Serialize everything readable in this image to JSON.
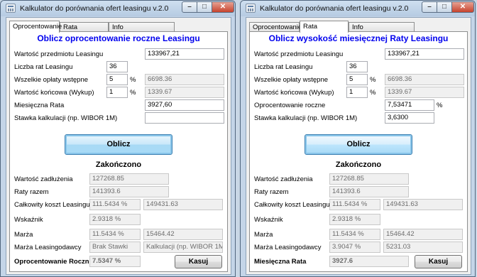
{
  "left": {
    "title": "Kalkulator do porównania ofert leasingu v.2.0",
    "tabs": [
      "Oprocentowanie",
      "Rata",
      "Info"
    ],
    "heading": "Oblicz oprocentowanie roczne Leasingu",
    "inputs": [
      {
        "label": "Wartość przedmiotu Leasingu",
        "value": "133967,21"
      },
      {
        "label": "Liczba rat Leasingu",
        "value": "36"
      },
      {
        "label": "Wszelkie opłaty wstępne",
        "value": "5",
        "unit": "%",
        "computed": "6698.36"
      },
      {
        "label": "Wartość końcowa (Wykup)",
        "value": "1",
        "unit": "%",
        "computed": "1339.67"
      },
      {
        "label": "Miesięczna Rata",
        "value": "3927,60"
      },
      {
        "label": "Stawka kalkulacji (np. WIBOR 1M)",
        "value": ""
      }
    ],
    "calc_button": "Oblicz",
    "status": "Zakończono",
    "results": [
      {
        "label": "Wartość zadłużenia",
        "value": "127268.85"
      },
      {
        "label": "Raty razem",
        "value": "141393.6"
      },
      {
        "label": "Całkowity koszt Leasingu",
        "value": "111.5434 %",
        "value2": "149431.63"
      },
      {
        "label": "Wskaźnik",
        "value": "2.9318 %"
      },
      {
        "label": "Marża",
        "value": "11.5434 %",
        "value2": "15464.42"
      },
      {
        "label": "Marża Leasingodawcy",
        "value": "Brak Stawki",
        "value2": "Kalkulacji (np. WIBOR 1M)"
      }
    ],
    "final": {
      "label": "Oprocentowanie Roczne",
      "value": "7.5347 %"
    },
    "clear_button": "Kasuj"
  },
  "right": {
    "title": "Kalkulator do porównania ofert leasingu v.2.0",
    "tabs": [
      "Oprocentowanie",
      "Rata",
      "Info"
    ],
    "heading": "Oblicz wysokość miesięcznej Raty Leasingu",
    "inputs": [
      {
        "label": "Wartość przedmiotu Leasingu",
        "value": "133967,21"
      },
      {
        "label": "Liczba rat Leasingu",
        "value": "36"
      },
      {
        "label": "Wszelkie opłaty wstępne",
        "value": "5",
        "unit": "%",
        "computed": "6698.36"
      },
      {
        "label": "Wartość końcowa (Wykup)",
        "value": "1",
        "unit": "%",
        "computed": "1339.67"
      },
      {
        "label": "Oprocentowanie roczne",
        "value": "7,53471",
        "unit": "%"
      },
      {
        "label": "Stawka kalkulacji (np. WIBOR 1M)",
        "value": "3,6300"
      }
    ],
    "calc_button": "Oblicz",
    "status": "Zakończono",
    "results": [
      {
        "label": "Wartość zadłużenia",
        "value": "127268.85"
      },
      {
        "label": "Raty razem",
        "value": "141393.6"
      },
      {
        "label": "Całkowity koszt Leasingu",
        "value": "111.5434 %",
        "value2": "149431.63"
      },
      {
        "label": "Wskaźnik",
        "value": "2.9318 %"
      },
      {
        "label": "Marża",
        "value": "11.5434 %",
        "value2": "15464.42"
      },
      {
        "label": "Marża Leasingodawcy",
        "value": "3.9047 %",
        "value2": "5231.03"
      }
    ],
    "final": {
      "label": "Miesięczna Rata",
      "value": "3927.6"
    },
    "clear_button": "Kasuj"
  },
  "colors": {
    "heading": "#0000ee",
    "button_accent": "#3c7fb1",
    "window_frame": "#c4d5e8"
  }
}
